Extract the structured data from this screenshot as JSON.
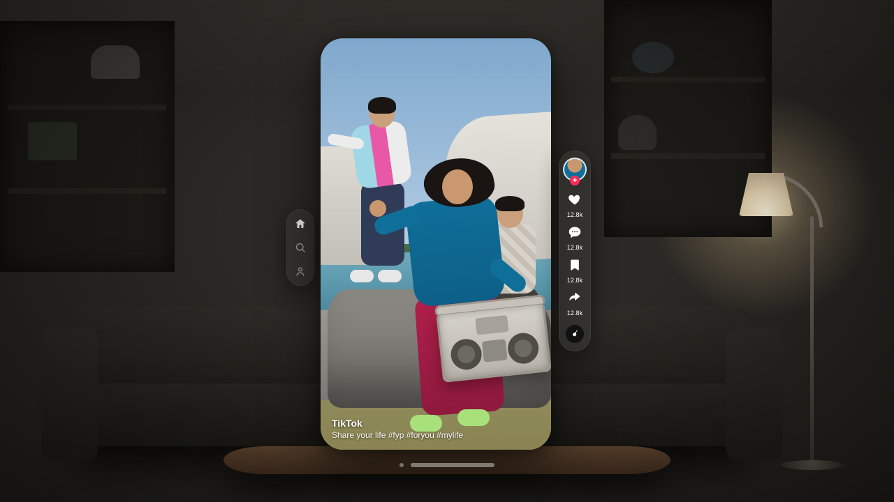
{
  "nav": {
    "items": [
      {
        "name": "home",
        "active": true
      },
      {
        "name": "search",
        "active": false
      },
      {
        "name": "profile",
        "active": false
      }
    ]
  },
  "video": {
    "author": "TikTok",
    "description": "Share your life #fyp #foryou #mylife"
  },
  "actions": {
    "like": {
      "count_label": "12.8k"
    },
    "comment": {
      "count_label": "12.8k"
    },
    "bookmark": {
      "count_label": "12.8k"
    },
    "share": {
      "count_label": "12.8k"
    },
    "avatar_follow_glyph": "+"
  }
}
